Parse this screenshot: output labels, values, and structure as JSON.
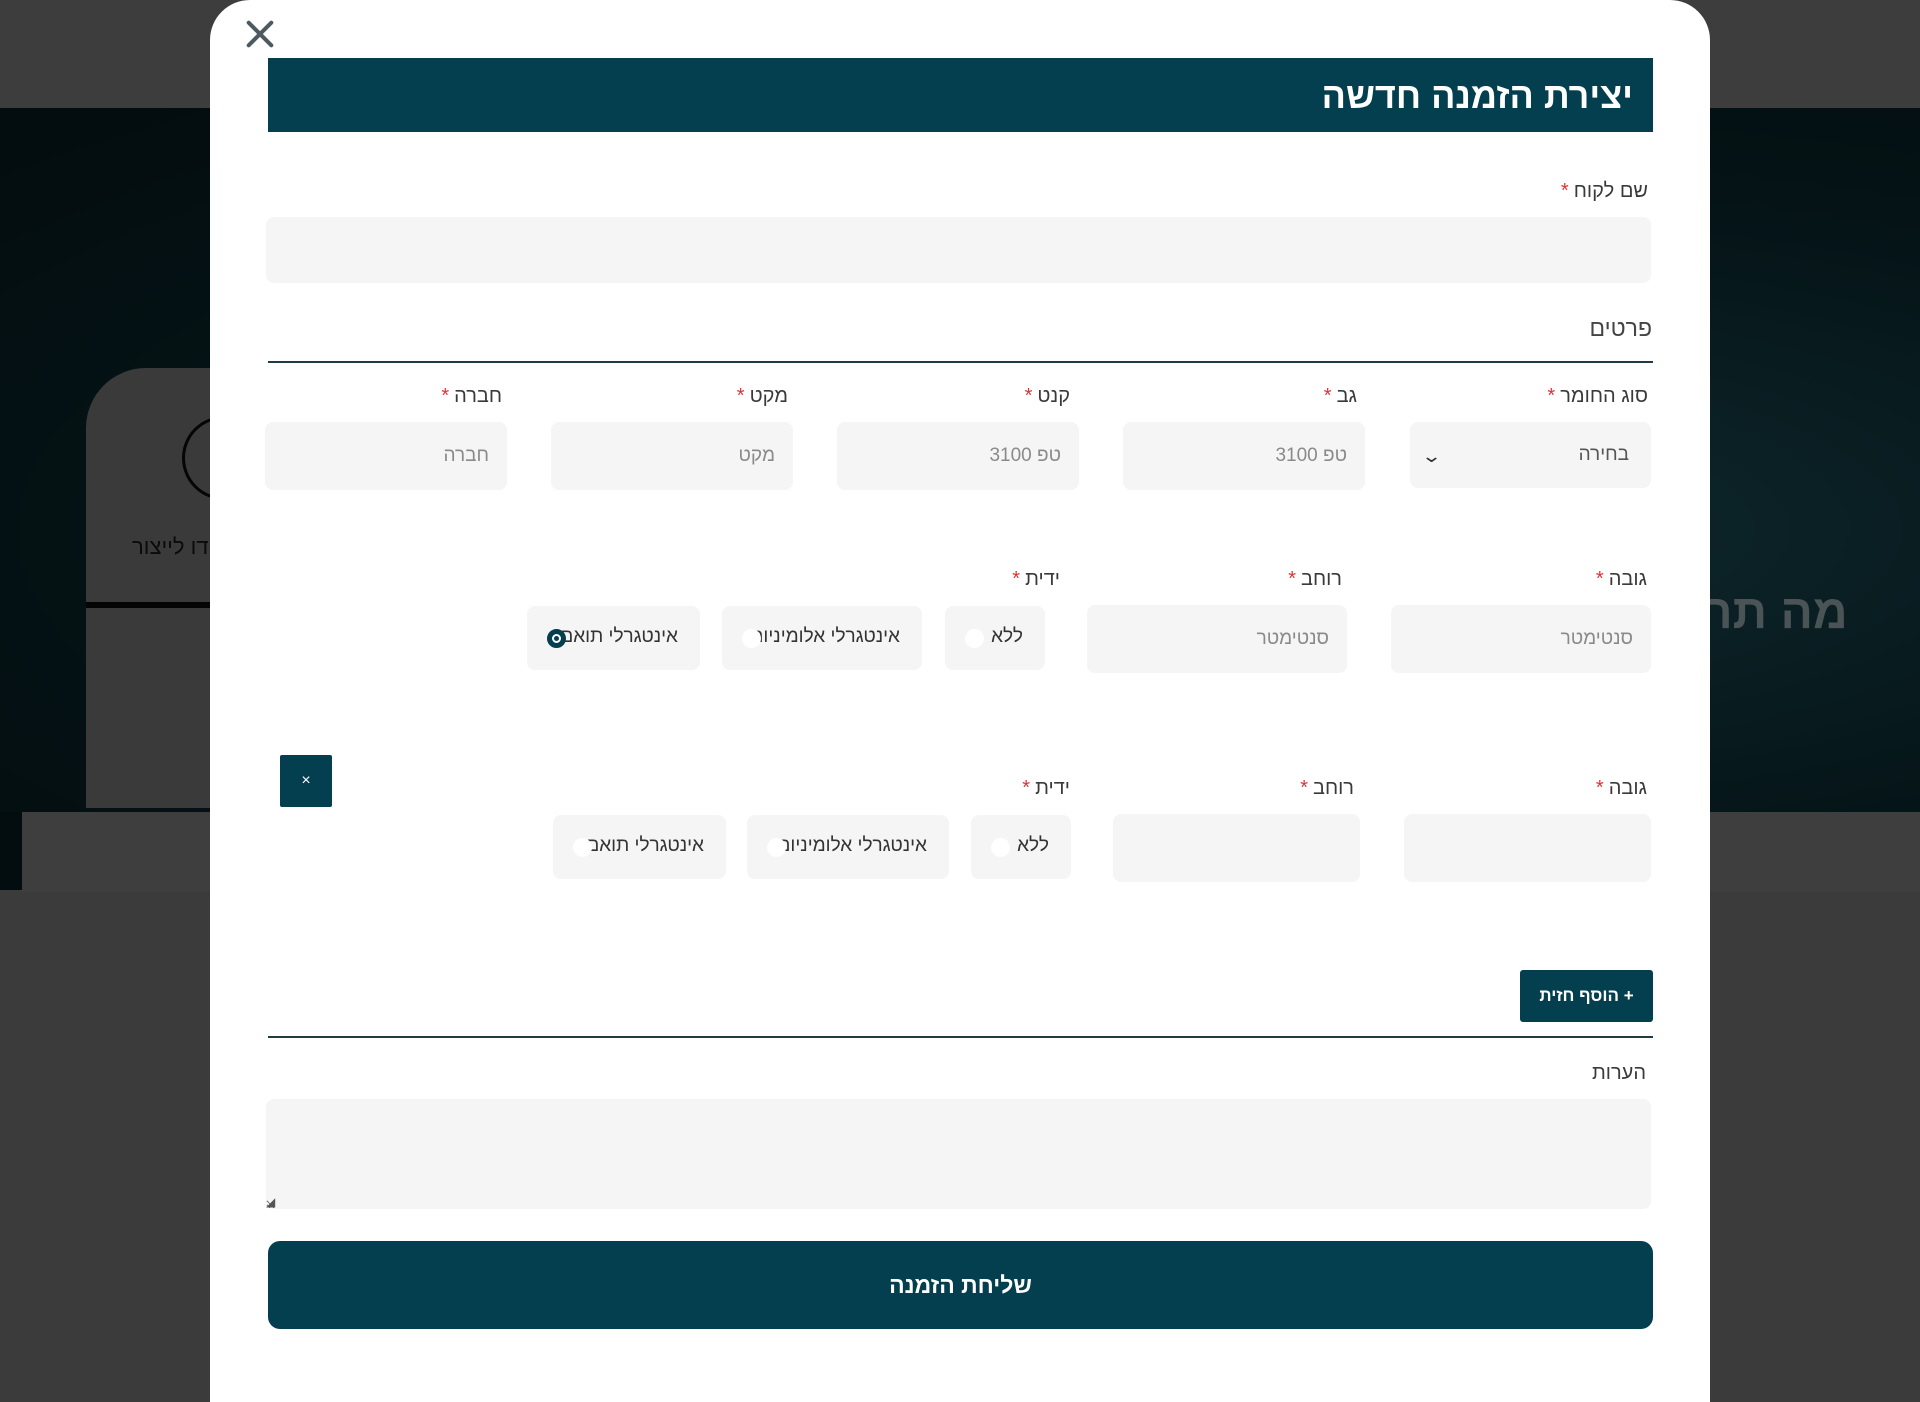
{
  "background": {
    "card_text": "דו לייצור",
    "hero_title": "מה תר"
  },
  "modal": {
    "title": "יצירת הזמנה חדשה",
    "close_icon": "close-icon"
  },
  "customer": {
    "label": "שם לקוח",
    "value": "",
    "required_mark": "*"
  },
  "details": {
    "section_title": "פרטים",
    "material": {
      "label": "סוג החומר",
      "value": "בחירה"
    },
    "gav": {
      "label": "גב",
      "placeholder": "טפ 3100"
    },
    "kant": {
      "label": "קנט",
      "placeholder": "טפ 3100"
    },
    "makat": {
      "label": "מקט",
      "placeholder": "מקט"
    },
    "company": {
      "label": "חברה",
      "placeholder": "חברה"
    }
  },
  "fronts": [
    {
      "height": {
        "label": "גובה",
        "placeholder": "סנטימטר"
      },
      "width": {
        "label": "רוחב",
        "placeholder": "סנטימטר"
      },
      "handle_label": "ידית",
      "handle_options": [
        {
          "label": "ללא",
          "checked": false
        },
        {
          "label": "אינטגרלי אלומיניום",
          "checked": false
        },
        {
          "label": "אינטגרלי תואם",
          "checked": true
        }
      ]
    },
    {
      "height": {
        "label": "גובה",
        "placeholder": ""
      },
      "width": {
        "label": "רוחב",
        "placeholder": ""
      },
      "handle_label": "ידית",
      "handle_options": [
        {
          "label": "ללא",
          "checked": false
        },
        {
          "label": "אינטגרלי אלומיניום",
          "checked": false
        },
        {
          "label": "אינטגרלי תואם",
          "checked": false
        }
      ],
      "remove_label": "×"
    }
  ],
  "add_front_label": "+ הוסף חזית",
  "notes": {
    "label": "הערות",
    "value": ""
  },
  "submit_label": "שליחת הזמנה",
  "colors": {
    "primary": "#033f4e",
    "required": "#dd3333",
    "field_bg": "#f5f5f5"
  }
}
